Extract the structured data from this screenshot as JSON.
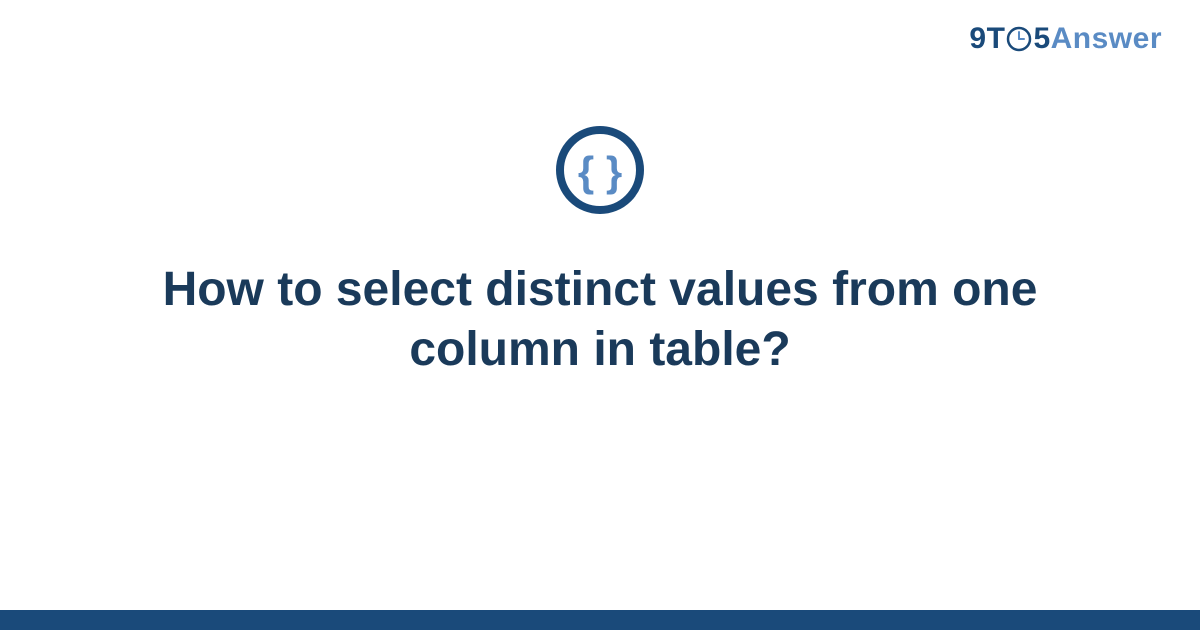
{
  "logo": {
    "part1": "9T",
    "part2": "5",
    "part3": "Answer"
  },
  "icon": {
    "name": "code-braces-icon"
  },
  "title": "How to select distinct values from one column in table?",
  "colors": {
    "dark_blue": "#1a4a7a",
    "light_blue": "#5a8bc4",
    "title_color": "#1a3a5a"
  }
}
